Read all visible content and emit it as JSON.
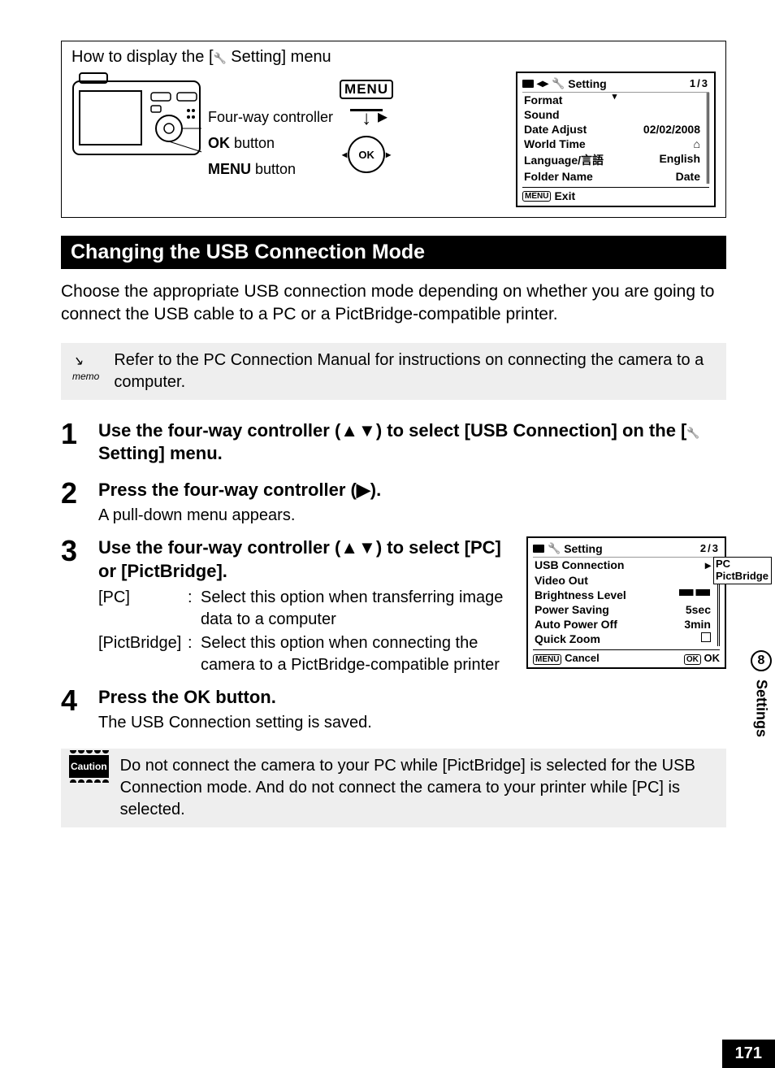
{
  "howto": {
    "title_pre": "How to display the [",
    "title_post": " Setting] menu",
    "labels": {
      "fourway": "Four-way controller",
      "ok_btn_bold": "OK",
      "ok_btn_rest": " button",
      "menu_btn_bold": "MENU",
      "menu_btn_rest": " button"
    },
    "menu_button_text": "MENU",
    "ok_circle_text": "OK"
  },
  "lcd1": {
    "header_text": "Setting",
    "page": "1/3",
    "rows": [
      {
        "k": "Format",
        "v": ""
      },
      {
        "k": "Sound",
        "v": ""
      },
      {
        "k": "Date Adjust",
        "v": "02/02/2008"
      },
      {
        "k": "World Time",
        "v": "⌂"
      },
      {
        "k": "Language/言語",
        "v": "English"
      },
      {
        "k": "Folder Name",
        "v": "Date"
      }
    ],
    "exit_key": "MENU",
    "exit_text": "Exit"
  },
  "section_title": "Changing the USB Connection Mode",
  "intro": "Choose the appropriate USB connection mode depending on whether you are going to connect the USB cable to a PC or a PictBridge-compatible printer.",
  "memo": {
    "label": "memo",
    "text": "Refer to the PC Connection Manual for instructions on connecting the camera to a computer."
  },
  "steps": {
    "s1": {
      "num": "1",
      "head_pre": "Use the four-way controller (▲▼) to select [USB Connection] on the [",
      "head_post": " Setting] menu."
    },
    "s2": {
      "num": "2",
      "head": "Press the four-way controller (▶).",
      "sub": "A pull-down menu appears."
    },
    "s3": {
      "num": "3",
      "head": "Use the four-way controller (▲▼) to select [PC] or [PictBridge].",
      "def1_key": "[PC]",
      "def1_val": "Select this option when transferring image data to a computer",
      "def2_key": "[PictBridge]",
      "def2_val": "Select this option when connecting the camera to a PictBridge-compatible printer"
    },
    "s4": {
      "num": "4",
      "head_pre": "Press the ",
      "head_bold": "OK",
      "head_post": " button.",
      "sub": "The USB Connection setting is saved."
    }
  },
  "lcd2": {
    "header_text": "Setting",
    "page": "2/3",
    "rows": {
      "usb_k": "USB Connection",
      "usb_opt1": "PC",
      "usb_opt2": "PictBridge",
      "video_k": "Video Out",
      "bright_k": "Brightness Level",
      "power_k": "Power Saving",
      "power_v": "5sec",
      "auto_k": "Auto Power Off",
      "auto_v": "3min",
      "zoom_k": "Quick Zoom"
    },
    "cancel_key": "MENU",
    "cancel_text": "Cancel",
    "ok_key": "OK",
    "ok_text": "OK"
  },
  "caution": {
    "label": "Caution",
    "text": "Do not connect the camera to your PC while [PictBridge] is selected for the USB Connection mode. And do not connect the camera to your printer while [PC] is selected."
  },
  "sidebar": {
    "chapter": "8",
    "label": "Settings"
  },
  "page_number": "171"
}
